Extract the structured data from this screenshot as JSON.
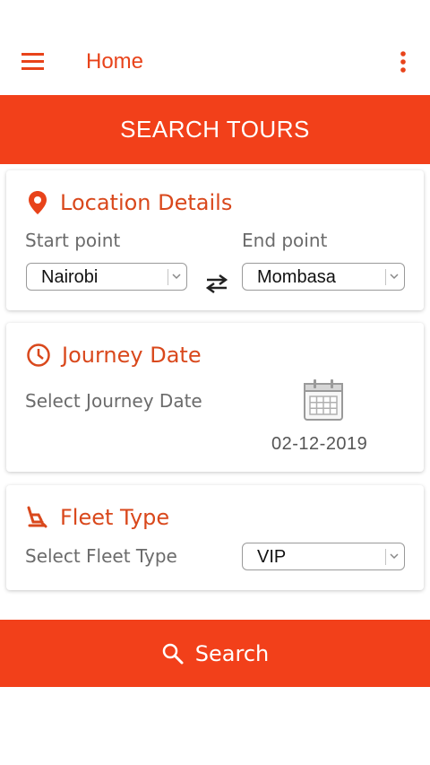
{
  "app": {
    "title": "Home"
  },
  "banner": {
    "title": "SEARCH TOURS"
  },
  "location": {
    "title": "Location Details",
    "start_label": "Start point",
    "end_label": "End point",
    "start_value": "Nairobi",
    "end_value": "Mombasa"
  },
  "journey": {
    "title": "Journey Date",
    "select_label": "Select Journey Date",
    "date_value": "02-12-2019"
  },
  "fleet": {
    "title": "Fleet Type",
    "select_label": "Select Fleet Type",
    "value": "VIP"
  },
  "actions": {
    "search_label": "Search"
  },
  "colors": {
    "accent": "#f2401a",
    "heading": "#d9481c"
  },
  "icons": [
    "menu-icon",
    "more-vert-icon",
    "location-pin-icon",
    "swap-icon",
    "clock-icon",
    "calendar-icon",
    "seat-icon",
    "search-icon",
    "chevron-down-icon"
  ]
}
